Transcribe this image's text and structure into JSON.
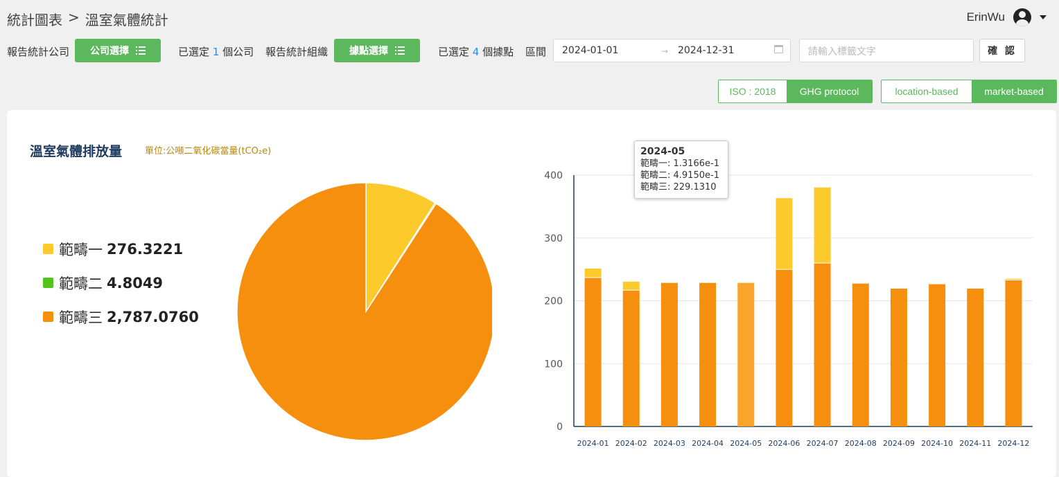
{
  "header": {
    "breadcrumb_parent": "統計圖表",
    "breadcrumb_sep": ">",
    "breadcrumb_current": "溫室氣體統計",
    "user_name": "ErinWu"
  },
  "filters": {
    "company_label": "報告統計公司",
    "company_button": "公司選擇",
    "company_selected_prefix": "已選定",
    "company_selected_count": "1",
    "company_selected_suffix": "個公司",
    "site_label": "報告統計組織",
    "site_button": "據點選擇",
    "site_selected_prefix": "已選定",
    "site_selected_count": "4",
    "site_selected_suffix": "個據點",
    "range_label": "區間",
    "date_start": "2024-01-01",
    "date_end": "2024-12-31",
    "tag_placeholder": "請輸入標籤文字",
    "confirm_button": "確 認"
  },
  "toggles": {
    "standard": [
      {
        "label": "ISO : 2018",
        "active": false
      },
      {
        "label": "GHG protocol",
        "active": true
      }
    ],
    "method": [
      {
        "label": "location-based",
        "active": false
      },
      {
        "label": "market-based",
        "active": true
      }
    ]
  },
  "card": {
    "title": "溫室氣體排放量",
    "unit": "單位:公噸二氧化碳當量(tCO₂e)"
  },
  "legend": [
    {
      "name": "範疇一",
      "value": "276.3221",
      "color": "#fdca2c"
    },
    {
      "name": "範疇二",
      "value": "4.8049",
      "color": "#52c41a"
    },
    {
      "name": "範疇三",
      "value": "2,787.0760",
      "color": "#f78f0e"
    }
  ],
  "tooltip": {
    "title": "2024-05",
    "lines": [
      "範疇一: 1.3166e-1",
      "範疇二: 4.9150e-1",
      "範疇三: 229.1310"
    ]
  },
  "chart_data": [
    {
      "type": "pie",
      "series": [
        {
          "name": "範疇一",
          "value": 276.3221,
          "color": "#fdca2c"
        },
        {
          "name": "範疇二",
          "value": 4.8049,
          "color": "#52c41a"
        },
        {
          "name": "範疇三",
          "value": 2787.076,
          "color": "#f78f0e"
        }
      ]
    },
    {
      "type": "bar",
      "stacked": true,
      "categories": [
        "2024-01",
        "2024-02",
        "2024-03",
        "2024-04",
        "2024-05",
        "2024-06",
        "2024-07",
        "2024-08",
        "2024-09",
        "2024-10",
        "2024-11",
        "2024-12"
      ],
      "ylim": [
        0,
        400
      ],
      "yticks": [
        0,
        100,
        200,
        300,
        400
      ],
      "series": [
        {
          "name": "範疇三",
          "color": "#f78f0e",
          "values": [
            237,
            217,
            229,
            229,
            229.131,
            250,
            260,
            228,
            220,
            227,
            220,
            233
          ]
        },
        {
          "name": "範疇二",
          "color": "#52c41a",
          "values": [
            0.4,
            0.4,
            0.4,
            0.4,
            0.4915,
            0.4,
            0.4,
            0.4,
            0.4,
            0.4,
            0.4,
            0.4
          ]
        },
        {
          "name": "範疇一",
          "color": "#fdca2c",
          "values": [
            14,
            13,
            0.13,
            0.13,
            0.13166,
            113,
            120,
            0.13,
            0.13,
            0.13,
            0.13,
            1.5
          ]
        }
      ],
      "highlight_category": "2024-05"
    }
  ]
}
